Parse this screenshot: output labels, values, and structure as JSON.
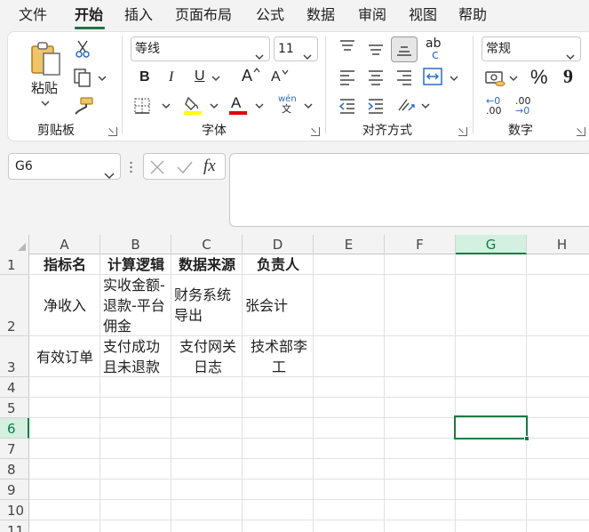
{
  "tabs": [
    {
      "label": "文件",
      "active": false
    },
    {
      "label": "开始",
      "active": true
    },
    {
      "label": "插入",
      "active": false
    },
    {
      "label": "页面布局",
      "active": false
    },
    {
      "label": "公式",
      "active": false
    },
    {
      "label": "数据",
      "active": false
    },
    {
      "label": "审阅",
      "active": false
    },
    {
      "label": "视图",
      "active": false
    },
    {
      "label": "帮助",
      "active": false
    }
  ],
  "ribbon": {
    "clipboard": {
      "group_label": "剪贴板",
      "paste_label": "粘贴"
    },
    "font": {
      "group_label": "字体",
      "font_name": "等线",
      "font_size": "11",
      "bold_label": "B",
      "italic_label": "I",
      "underline_label": "U",
      "grow_label": "A",
      "shrink_label": "A",
      "font_color_label": "A",
      "phonetic_top": "wén",
      "phonetic_bottom": "文",
      "fill_color": "#ffff00",
      "font_color": "#e00000"
    },
    "alignment": {
      "group_label": "对齐方式",
      "wrap_top": "ab",
      "wrap_bottom": "c"
    },
    "number": {
      "group_label": "数字",
      "format": "常规",
      "percent_label": "%",
      "comma_label": "9",
      "inc_decimal_top": "←0",
      "inc_decimal_bottom": ".00",
      "dec_decimal_top": ".00",
      "dec_decimal_bottom": "→0"
    }
  },
  "formula_bar": {
    "name_box": "G6",
    "fx_label": "fx",
    "content": ""
  },
  "columns": [
    "A",
    "B",
    "C",
    "D",
    "E",
    "F",
    "G",
    "H"
  ],
  "selected_column": "G",
  "rows": [
    "1",
    "2",
    "3",
    "4",
    "5",
    "6",
    "7",
    "8",
    "9",
    "10",
    "11"
  ],
  "selected_row": "6",
  "cells": {
    "A1": "指标名",
    "B1": "计算逻辑",
    "C1": "数据来源",
    "D1": "负责人",
    "A2": "净收入",
    "B2": "实收金额-退款-平台佣金",
    "C2": "财务系统导出",
    "D2": "张会计",
    "A3": "有效订单",
    "B3": "支付成功且未退款",
    "C3": "支付网关日志",
    "D3": "技术部李工"
  },
  "colors": {
    "accent": "#107c41",
    "selection_bg": "#d3f0e0"
  }
}
